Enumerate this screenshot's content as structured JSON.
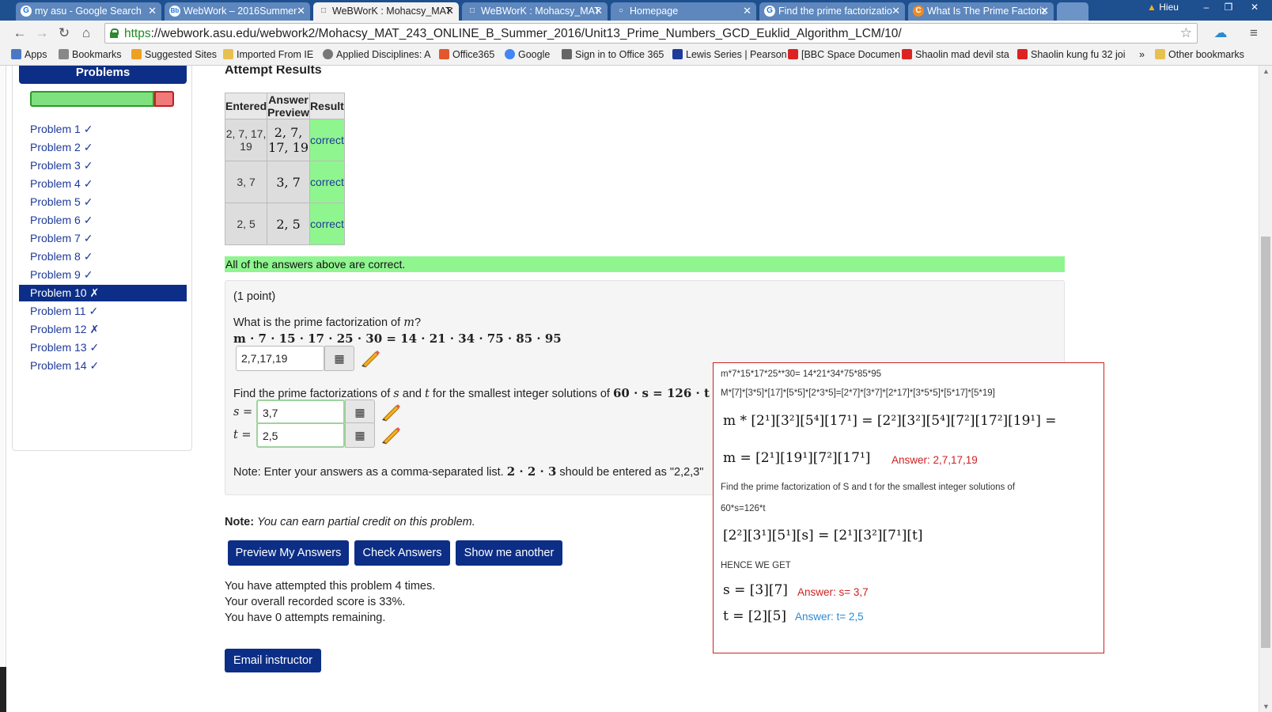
{
  "browser": {
    "tabs": [
      {
        "title": "my asu - Google Search",
        "icon": "G"
      },
      {
        "title": "WebWork – 2016Summer",
        "icon": "Bb"
      },
      {
        "title": "WeBWorK : Mohacsy_MAT",
        "icon": "□",
        "active": true
      },
      {
        "title": "WeBWorK : Mohacsy_MAT",
        "icon": "□"
      },
      {
        "title": "Homepage",
        "icon": "○"
      },
      {
        "title": "Find the prime factorizatio",
        "icon": "G"
      },
      {
        "title": "What Is The Prime Factoriz",
        "icon": "C"
      }
    ],
    "user": "Hieu",
    "url_scheme": "https",
    "url_rest": "://webwork.asu.edu/webwork2/Mohacsy_MAT_243_ONLINE_B_Summer_2016/Unit13_Prime_Numbers_GCD_Euklid_Algorithm_LCM/10/",
    "bookmarks": [
      "Apps",
      "Bookmarks",
      "Suggested Sites",
      "Imported From IE",
      "Applied Disciplines: A",
      "Office365",
      "Google",
      "Sign in to Office 365",
      "Lewis Series | Pearson",
      "[BBC Space Documen",
      "Shaolin mad devil sta",
      "Shaolin kung fu 32 joi",
      "»",
      "Other bookmarks"
    ]
  },
  "sidebar": {
    "heading": "Problems",
    "progress_correct_fraction": 0.86,
    "items": [
      {
        "label": "Problem 1 ✓"
      },
      {
        "label": "Problem 2 ✓"
      },
      {
        "label": "Problem 3 ✓"
      },
      {
        "label": "Problem 4 ✓"
      },
      {
        "label": "Problem 5 ✓"
      },
      {
        "label": "Problem 6 ✓"
      },
      {
        "label": "Problem 7 ✓"
      },
      {
        "label": "Problem 8 ✓"
      },
      {
        "label": "Problem 9 ✓"
      },
      {
        "label": "Problem 10 ✗",
        "active": true
      },
      {
        "label": "Problem 11 ✓"
      },
      {
        "label": "Problem 12 ✗"
      },
      {
        "label": "Problem 13 ✓"
      },
      {
        "label": "Problem 14 ✓"
      }
    ]
  },
  "results": {
    "title": "Attempt Results",
    "headers": [
      "Entered",
      "Answer Preview",
      "Result"
    ],
    "rows": [
      {
        "entered": "2, 7, 17, 19",
        "preview": "2, 7, 17, 19",
        "result": "correct"
      },
      {
        "entered": "3, 7",
        "preview": "3, 7",
        "result": "correct"
      },
      {
        "entered": "2, 5",
        "preview": "2, 5",
        "result": "correct"
      }
    ],
    "summary": "All of the answers above are correct."
  },
  "problem": {
    "points": "(1 point)",
    "q1_prefix": "What is the prime factorization of",
    "q1_var": "m",
    "q1_suffix": "?",
    "q1_equation": "m · 7 · 15 · 17 · 25 · 30 = 14 · 21 · 34 · 75 · 85 · 95",
    "answer_m": "2,7,17,19",
    "q2_text_a": "Find the prime factorizations of",
    "q2_var_s": "s",
    "q2_and": "and",
    "q2_var_t": "t",
    "q2_text_b": "for the smallest integer solutions of",
    "q2_equation": "60 · s = 126 · t",
    "label_s": "s =",
    "answer_s": "3,7",
    "label_t": "t =",
    "answer_t": "2,5",
    "note_prefix": "Note: Enter your answers as a comma-separated list.",
    "note_math": "2 · 2 · 3",
    "note_suffix": "should be entered as \"2,2,3\"",
    "grid_icon": "keypad-grid-icon",
    "pencil_icon": "pencil-icon"
  },
  "footer": {
    "note_bold": "Note:",
    "note_italic": "You can earn partial credit on this problem.",
    "preview_btn": "Preview My Answers",
    "check_btn": "Check Answers",
    "another_btn": "Show me another",
    "attempts_line": "You have attempted this problem 4 times.",
    "score_line": "Your overall recorded score is 33%.",
    "remaining_line": "You have 0 attempts remaining.",
    "email_btn": "Email instructor"
  },
  "overlay": {
    "line1": "m*7*15*17*25**30= 14*21*34*75*85*95",
    "line2": "M*[7]*[3*5]*[17]*[5*5]*[2*3*5]=[2*7]*[3*7]*[2*17]*[3*5*5]*[5*17]*[5*19]",
    "eq1": "m * [2¹][3²][5⁴][17¹] = [2²][3²][5⁴][7²][17²][19¹] =",
    "eq2": "m = [2¹][19¹][7²][17¹]",
    "answer1": "Answer: 2,7,17,19",
    "line3": "Find the prime factorization of S and t for the smallest integer solutions of",
    "line4": "60*s=126*t",
    "eq3": "[2²][3¹][5¹][s] = [2¹][3²][7¹][t]",
    "hence": "HENCE WE GET",
    "eq4": "s = [3][7]",
    "answer_s": "Answer: s= 3,7",
    "eq5": "t = [2][5]",
    "answer_t": "Answer: t= 2,5"
  },
  "colors": {
    "accent_navy": "#0c2e86",
    "correct_green": "#8ff58f",
    "overlay_red": "#cc2222",
    "overlay_blue": "#2a8ad4"
  }
}
